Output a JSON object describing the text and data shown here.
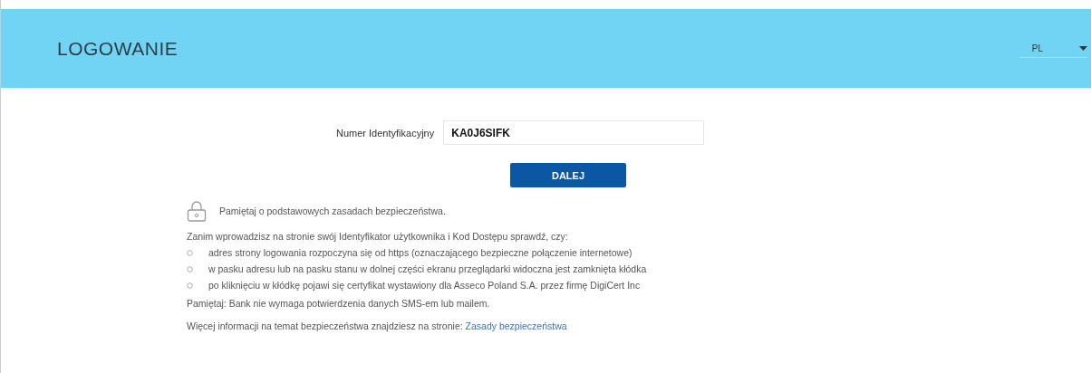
{
  "header": {
    "title": "LOGOWANIE",
    "language": "PL"
  },
  "form": {
    "label": "Numer Identyfikacyjny",
    "value": "KA0J6SIFK",
    "button": "DALEJ"
  },
  "security": {
    "heading": "Pamiętaj o podstawowych zasadach bezpieczeństwa.",
    "intro": "Zanim wprowadzisz na stronie swój Identyfikator użytkownika i Kod Dostępu sprawdź, czy:",
    "items": [
      "adres strony logowania rozpoczyna się od https (oznaczającego bezpieczne połączenie internetowe)",
      "w pasku adresu lub na pasku stanu w dolnej części ekranu przeglądarki widoczna jest zamknięta kłódka",
      "po kliknięciu w kłódkę pojawi się certyfikat wystawiony dla Asseco Poland S.A. przez firmę DigiCert Inc"
    ],
    "note": "Pamiętaj: Bank nie wymaga potwierdzenia danych SMS-em lub mailem.",
    "more": "Więcej informacji na temat bezpieczeństwa znajdziesz na stronie:",
    "link": "Zasady bezpieczeństwa"
  }
}
